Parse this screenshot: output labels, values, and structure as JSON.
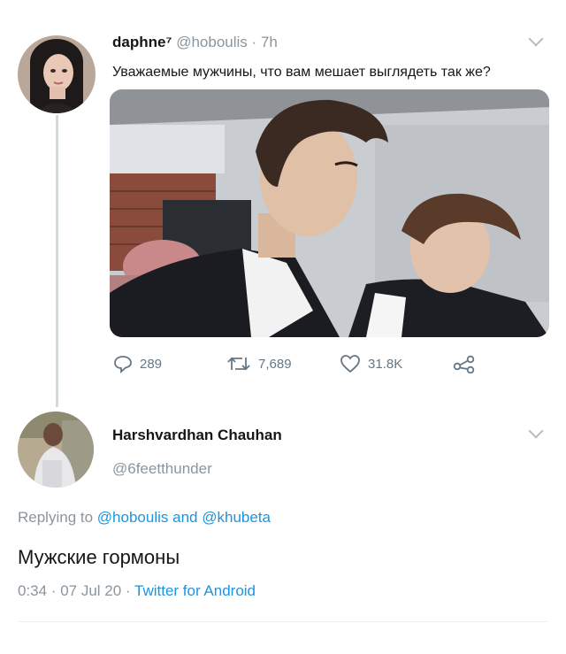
{
  "tweet": {
    "display_name": "daphne⁷",
    "handle": "@hoboulis",
    "time": "· 7h",
    "text": "Уважаемые мужчины, что вам мешает выглядеть так же?",
    "replies": "289",
    "retweets": "7,689",
    "likes": "31.8K"
  },
  "reply": {
    "display_name": "Harshvardhan Chauhan",
    "handle": "@6feetthunder",
    "replying_prefix": "Replying to",
    "replying_user1": "@hoboulis",
    "replying_and": "and",
    "replying_user2": "@khubeta",
    "text": "Мужские гормоны",
    "meta_time": "0:34 · 07 Jul 20 ·",
    "meta_source": "Twitter for Android"
  },
  "colors": {
    "link": "#1b95e0",
    "muted": "#8a959e",
    "thread_line": "#cfd9de"
  }
}
